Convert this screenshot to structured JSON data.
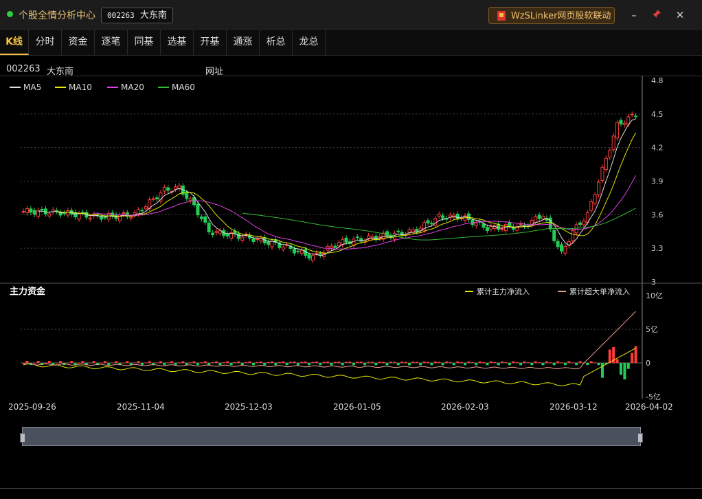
{
  "window": {
    "title": "个股全情分析中心",
    "stock_code": "002263",
    "stock_name": "大东南",
    "linker_label": "WzSLinker网页股软联动",
    "controls": {
      "minimize": "–",
      "pin": "📌",
      "close": "✕"
    }
  },
  "tabs": [
    "K线",
    "分时",
    "资金",
    "逐笔",
    "同基",
    "选基",
    "开基",
    "通涨",
    "析总",
    "龙总"
  ],
  "active_tab": "K线",
  "info_bar": {
    "code": "002263",
    "name": "大东南",
    "link": "网址"
  },
  "colors": {
    "up": "#ff3b3b",
    "down": "#22cc55",
    "ma5": "#e0e0e0",
    "ma10": "#e6e600",
    "ma20": "#e040e0",
    "ma60": "#33bb33",
    "main_flow": "#e6e600",
    "super_flow": "#f0a090",
    "accent": "#f5c542"
  },
  "chart_data": [
    {
      "type": "candlestick",
      "legend": [
        "MA5",
        "MA10",
        "MA20",
        "MA60"
      ],
      "y_ticks": [
        "4.8",
        "4.5",
        "4.2",
        "3.9",
        "3.6",
        "3.3",
        "3"
      ],
      "ylim": [
        3.0,
        4.8
      ],
      "grid": true,
      "legend_placement": "top-left"
    },
    {
      "type": "line",
      "title": "主力资金",
      "legend": [
        "累计主力净流入",
        "累计超大单净流入"
      ],
      "y_ticks": [
        "10亿",
        "5亿",
        "0",
        "-5亿"
      ],
      "ylim": [
        -5,
        10
      ],
      "x_ticks": [
        "2025-09-26",
        "2025-11-04",
        "2025-12-03",
        "2026-01-05",
        "2026-02-03",
        "2026-03-12",
        "2026-04-02"
      ],
      "legend_placement": "top-right"
    }
  ]
}
